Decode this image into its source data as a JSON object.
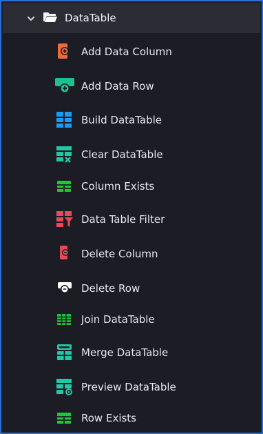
{
  "group": {
    "title": "DataTable",
    "expanded": true,
    "chevron_icon": "chevron-down-icon",
    "folder_icon": "folder-open-icon"
  },
  "items": [
    {
      "label": "Add Data Column",
      "icon": "add-data-column-icon",
      "color": "#ef6a3a"
    },
    {
      "label": "Add Data Row",
      "icon": "add-data-row-icon",
      "color": "#1fbf8f"
    },
    {
      "label": "Build DataTable",
      "icon": "build-datatable-icon",
      "color": "#1e9bf0"
    },
    {
      "label": "Clear DataTable",
      "icon": "clear-datatable-icon",
      "color": "#24c7a4"
    },
    {
      "label": "Column Exists",
      "icon": "column-exists-icon",
      "color": "#25c23b"
    },
    {
      "label": "Data Table Filter",
      "icon": "data-table-filter-icon",
      "color": "#e8495a"
    },
    {
      "label": "Delete Column",
      "icon": "delete-column-icon",
      "color": "#e8495a"
    },
    {
      "label": "Delete Row",
      "icon": "delete-row-icon",
      "color": "#ffffff"
    },
    {
      "label": "Join DataTable",
      "icon": "join-datatable-icon",
      "color": "#25c23b"
    },
    {
      "label": "Merge DataTable",
      "icon": "merge-datatable-icon",
      "color": "#24c7a4"
    },
    {
      "label": "Preview DataTable",
      "icon": "preview-datatable-icon",
      "color": "#24c7a4"
    },
    {
      "label": "Row Exists",
      "icon": "row-exists-icon",
      "color": "#25c23b"
    }
  ]
}
